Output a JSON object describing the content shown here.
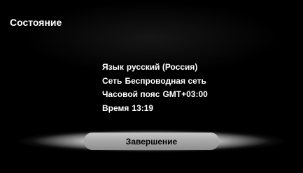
{
  "screen": {
    "title": "Состояние"
  },
  "status": {
    "items": [
      {
        "label": "Язык",
        "value": "русский (Россия)"
      },
      {
        "label": "Сеть",
        "value": "Беспроводная сеть"
      },
      {
        "label": "Часовой пояс",
        "value": "GMT+03:00"
      },
      {
        "label": "Время",
        "value": "13:19"
      }
    ]
  },
  "actions": {
    "finish_label": "Завершение"
  },
  "colors": {
    "background": "#000000",
    "text": "#ffffff",
    "button": "#a9a9a9",
    "button_text": "#000000"
  }
}
